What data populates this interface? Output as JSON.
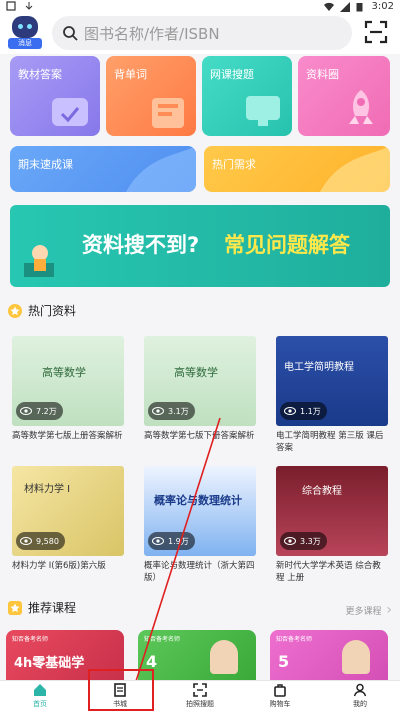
{
  "status_bar": {
    "time": "3:02"
  },
  "header": {
    "logo_tag": "消息",
    "search_placeholder": "图书名称/作者/ISBN"
  },
  "tiles": {
    "row1": [
      "教材答案",
      "背单词",
      "网课搜题",
      "资料圈"
    ],
    "row2": [
      "期末速成课",
      "热门需求"
    ],
    "colors": [
      "#9a8cf0",
      "#ff8a5c",
      "#35d0bf",
      "#f57ec0",
      "#5b9df5",
      "#ffbe3b"
    ]
  },
  "banner": {
    "text_white": "资料搜不到?",
    "text_yellow": "常见问题解答"
  },
  "hot_section": {
    "title": "热门资料"
  },
  "books": [
    {
      "cover_title": "高等数学",
      "views": "7.2万",
      "title": "高等数学第七版上册答案解析"
    },
    {
      "cover_title": "高等数学",
      "views": "3.1万",
      "title": "高等数学第七版下册答案解析"
    },
    {
      "cover_title": "电工学简明教程",
      "views": "1.1万",
      "title": "电工学简明教程 第三版 课后答案"
    },
    {
      "cover_title": "材料力学 I",
      "views": "9,580",
      "title": "材料力学 I(第6版)第六版"
    },
    {
      "cover_title": "概率论与数理统计",
      "views": "1.9万",
      "title": "概率论与数理统计（浙大第四版）"
    },
    {
      "cover_title": "综合教程",
      "views": "3.3万",
      "title": "新时代大学学术英语 综合教程 上册"
    }
  ],
  "course_section": {
    "title": "推荐课程",
    "more": "更多课程"
  },
  "courses": [
    {
      "tag": "知否备考名师",
      "big": "4h零基础学"
    },
    {
      "tag": "知否备考名师",
      "big": "4"
    },
    {
      "tag": "知否备考名师",
      "big": "5"
    }
  ],
  "nav": [
    "首页",
    "书城",
    "拍照搜题",
    "购物车",
    "我的"
  ]
}
